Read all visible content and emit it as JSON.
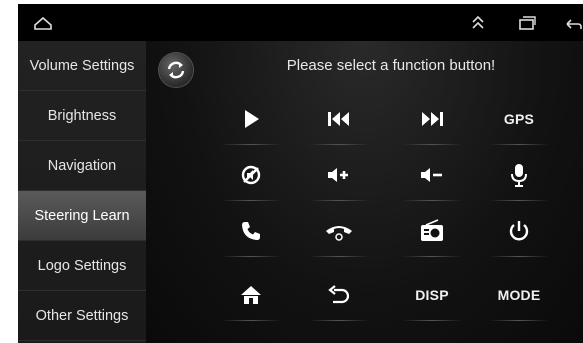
{
  "sidebar": {
    "items": [
      {
        "label": "Volume Settings",
        "active": false
      },
      {
        "label": "Brightness",
        "active": false
      },
      {
        "label": "Navigation",
        "active": false
      },
      {
        "label": "Steering Learn",
        "active": true
      },
      {
        "label": "Logo Settings",
        "active": false
      },
      {
        "label": "Other Settings",
        "active": false
      }
    ]
  },
  "main": {
    "prompt": "Please select a function button!",
    "buttons": {
      "gps": "GPS",
      "disp": "DISP",
      "mode": "MODE"
    }
  },
  "icons": {
    "topbar": [
      "home-outline-icon",
      "chevron-double-up-icon",
      "recent-apps-icon",
      "back-arrow-icon"
    ],
    "function_grid": [
      "play-icon",
      "previous-track-icon",
      "next-track-icon",
      "gps-text",
      "mute-icon",
      "volume-up-icon",
      "volume-down-icon",
      "microphone-icon",
      "phone-answer-icon",
      "phone-hangup-icon",
      "radio-icon",
      "power-icon",
      "home-icon",
      "return-icon",
      "disp-text",
      "mode-text"
    ]
  },
  "colors": {
    "background": "#0b0b0b",
    "active_item": "#4a4a4a",
    "text": "#e6e6e6"
  }
}
